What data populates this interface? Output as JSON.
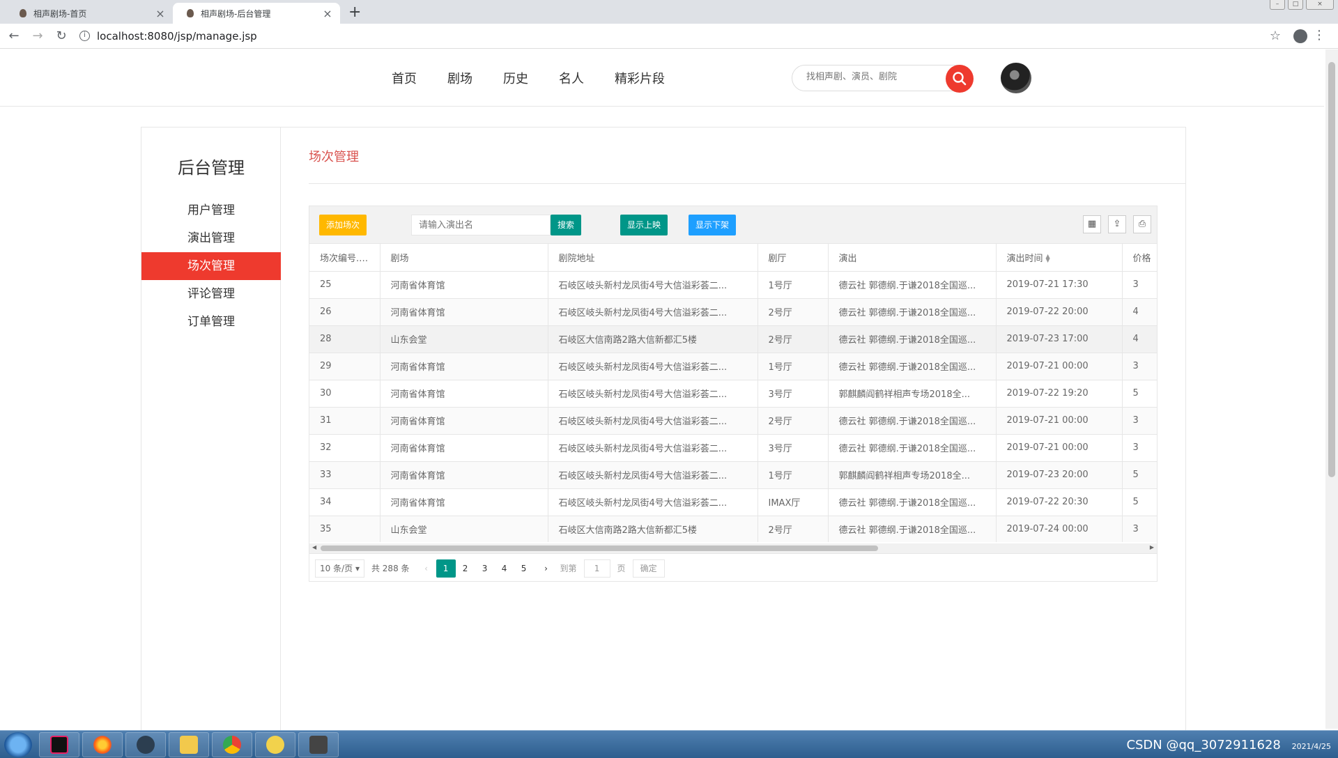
{
  "browser": {
    "tabs": [
      {
        "title": "相声剧场-首页",
        "active": false
      },
      {
        "title": "相声剧场-后台管理",
        "active": true
      }
    ],
    "url": "localhost:8080/jsp/manage.jsp"
  },
  "header": {
    "nav": [
      "首页",
      "剧场",
      "历史",
      "名人",
      "精彩片段"
    ],
    "search_placeholder": "找相声剧、演员、剧院"
  },
  "sidebar": {
    "title": "后台管理",
    "items": [
      {
        "label": "用户管理",
        "active": false
      },
      {
        "label": "演出管理",
        "active": false
      },
      {
        "label": "场次管理",
        "active": true
      },
      {
        "label": "评论管理",
        "active": false
      },
      {
        "label": "订单管理",
        "active": false
      }
    ]
  },
  "main": {
    "title": "场次管理",
    "toolbar": {
      "add_label": "添加场次",
      "search_placeholder": "请输入演出名",
      "search_label": "搜索",
      "show_on_label": "显示上映",
      "show_off_label": "显示下架"
    },
    "columns": [
      "场次编号...",
      "剧场",
      "剧院地址",
      "剧厅",
      "演出",
      "演出时间",
      "价格"
    ],
    "rows": [
      [
        "25",
        "河南省体育馆",
        "石岐区岐头新村龙凤街4号大信溢彩荟二...",
        "1号厅",
        "德云社 郭德纲.于谦2018全国巡...",
        "2019-07-21 17:30",
        "3"
      ],
      [
        "26",
        "河南省体育馆",
        "石岐区岐头新村龙凤街4号大信溢彩荟二...",
        "2号厅",
        "德云社 郭德纲.于谦2018全国巡...",
        "2019-07-22 20:00",
        "4"
      ],
      [
        "28",
        "山东会堂",
        "石岐区大信南路2路大信新都汇5楼",
        "2号厅",
        "德云社 郭德纲.于谦2018全国巡...",
        "2019-07-23 17:00",
        "4"
      ],
      [
        "29",
        "河南省体育馆",
        "石岐区岐头新村龙凤街4号大信溢彩荟二...",
        "1号厅",
        "德云社 郭德纲.于谦2018全国巡...",
        "2019-07-21 00:00",
        "3"
      ],
      [
        "30",
        "河南省体育馆",
        "石岐区岐头新村龙凤街4号大信溢彩荟二...",
        "3号厅",
        "郭麒麟阎鹤祥相声专场2018全...",
        "2019-07-22 19:20",
        "5"
      ],
      [
        "31",
        "河南省体育馆",
        "石岐区岐头新村龙凤街4号大信溢彩荟二...",
        "2号厅",
        "德云社 郭德纲.于谦2018全国巡...",
        "2019-07-21 00:00",
        "3"
      ],
      [
        "32",
        "河南省体育馆",
        "石岐区岐头新村龙凤街4号大信溢彩荟二...",
        "3号厅",
        "德云社 郭德纲.于谦2018全国巡...",
        "2019-07-21 00:00",
        "3"
      ],
      [
        "33",
        "河南省体育馆",
        "石岐区岐头新村龙凤街4号大信溢彩荟二...",
        "1号厅",
        "郭麒麟阎鹤祥相声专场2018全...",
        "2019-07-23 20:00",
        "5"
      ],
      [
        "34",
        "河南省体育馆",
        "石岐区岐头新村龙凤街4号大信溢彩荟二...",
        "IMAX厅",
        "德云社 郭德纲.于谦2018全国巡...",
        "2019-07-22 20:30",
        "5"
      ],
      [
        "35",
        "山东会堂",
        "石岐区大信南路2路大信新都汇5楼",
        "2号厅",
        "德云社 郭德纲.于谦2018全国巡...",
        "2019-07-24 00:00",
        "3"
      ]
    ],
    "pager": {
      "limit": "10 条/页",
      "total": "共 288 条",
      "pages": [
        "1",
        "2",
        "3",
        "4",
        "5"
      ],
      "current": "1",
      "goto_label": "到第",
      "goto_value": "1",
      "page_unit": "页",
      "confirm_label": "确定"
    }
  },
  "taskbar": {
    "tray_text": "CSDN @qq_3072911628",
    "date": "2021/4/25"
  },
  "colors": {
    "accent_red": "#ee3a2e",
    "teal": "#009688",
    "blue": "#1e9fff",
    "yellow": "#ffb800",
    "title_red": "#d9534f"
  }
}
